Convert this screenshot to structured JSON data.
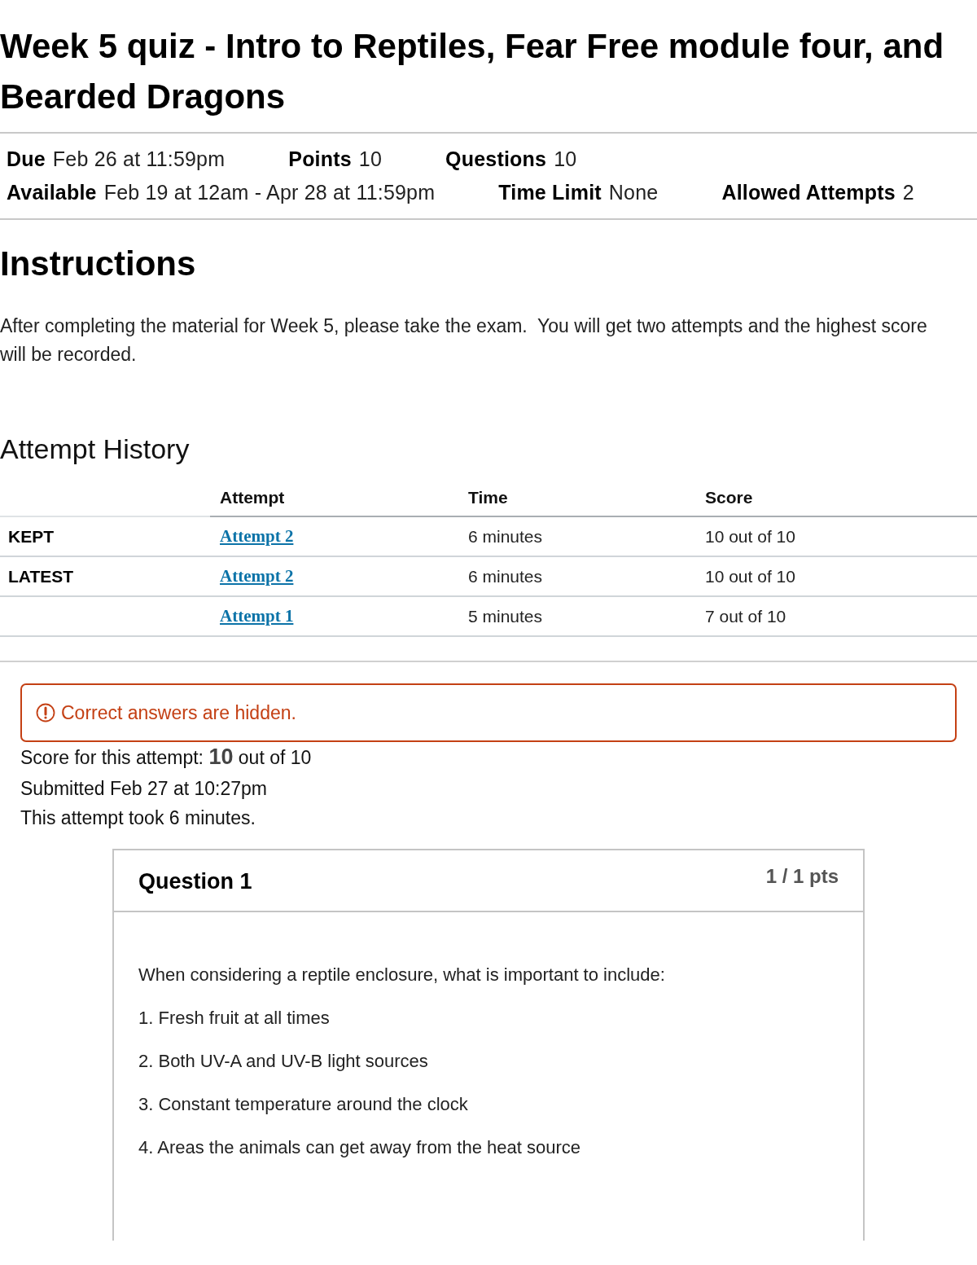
{
  "title": "Week 5 quiz - Intro to Reptiles, Fear Free module four, and Bearded Dragons",
  "details": [
    [
      {
        "label": "Due",
        "value": "Feb 26 at 11:59pm"
      },
      {
        "label": "Points",
        "value": "10"
      },
      {
        "label": "Questions",
        "value": "10"
      }
    ],
    [
      {
        "label": "Available",
        "value": "Feb 19 at 12am - Apr 28 at 11:59pm"
      },
      {
        "label": "Time Limit",
        "value": "None"
      },
      {
        "label": "Allowed Attempts",
        "value": "2"
      }
    ]
  ],
  "instructions": {
    "heading": "Instructions",
    "text": "After completing the material for Week 5, please take the exam.  You will get two attempts and the highest score will be recorded."
  },
  "attempt_history": {
    "heading": "Attempt History",
    "columns": [
      "Attempt",
      "Time",
      "Score"
    ],
    "rows": [
      {
        "label": "KEPT",
        "attempt": "Attempt 2",
        "time": "6 minutes",
        "score": "10 out of 10"
      },
      {
        "label": "LATEST",
        "attempt": "Attempt 2",
        "time": "6 minutes",
        "score": "10 out of 10"
      },
      {
        "attempt": "Attempt 1",
        "time": "5 minutes",
        "score": "7 out of 10"
      }
    ]
  },
  "alert": {
    "text": "Correct answers are hidden."
  },
  "result": {
    "score": "Score for this attempt: **10** out of 10",
    "submitted": "Submitted Feb 27 at 10:27pm",
    "duration": "This attempt took 6 minutes."
  },
  "question": {
    "title": "Question 1",
    "points": "1 / 1 pts",
    "prompt": "When considering a reptile enclosure, what is important to include:",
    "options": [
      "1. Fresh fruit at all times",
      "2. Both UV-A and UV-B light sources",
      "3. Constant temperature around the clock",
      "4. Areas the animals can get away from the heat source"
    ]
  }
}
